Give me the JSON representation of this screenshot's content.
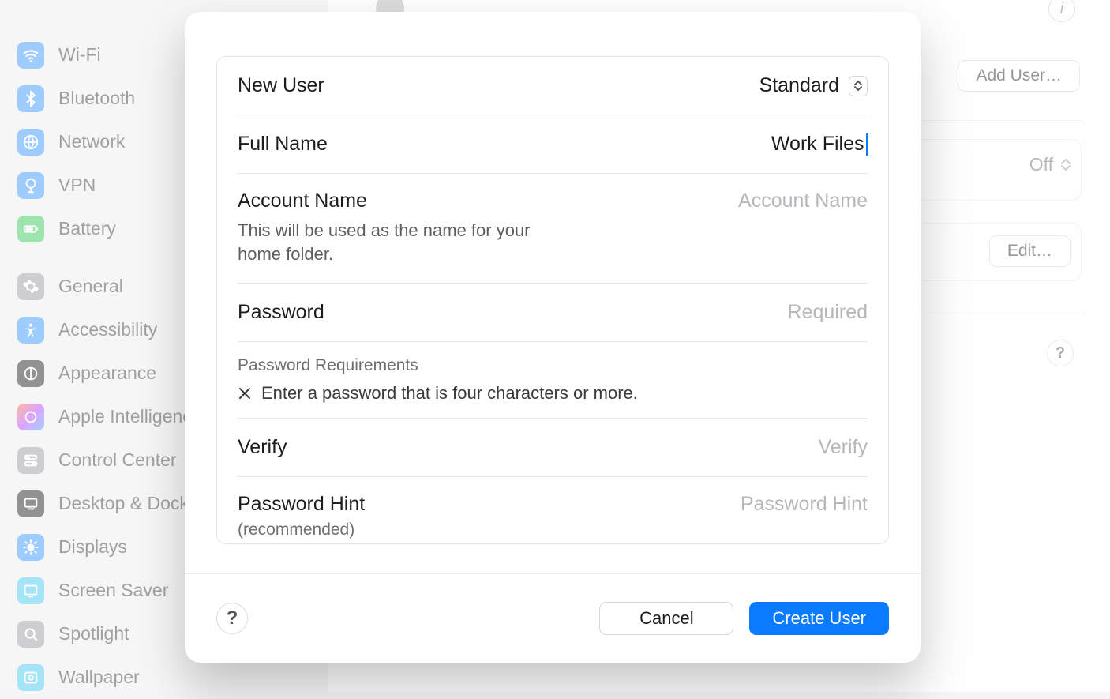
{
  "sidebar": {
    "items": [
      {
        "label": "Wi-Fi",
        "icon": "wifi",
        "bg": "#3895ff"
      },
      {
        "label": "Bluetooth",
        "icon": "bluetooth",
        "bg": "#3895ff"
      },
      {
        "label": "Network",
        "icon": "network",
        "bg": "#3895ff"
      },
      {
        "label": "VPN",
        "icon": "vpn",
        "bg": "#3895ff"
      },
      {
        "label": "Battery",
        "icon": "battery",
        "bg": "#34c759"
      },
      {
        "label": "General",
        "icon": "general",
        "bg": "#9a9aa0"
      },
      {
        "label": "Accessibility",
        "icon": "accessibility",
        "bg": "#3895ff"
      },
      {
        "label": "Appearance",
        "icon": "appearance",
        "bg": "#1c1c1e"
      },
      {
        "label": "Apple Intelligence",
        "icon": "ai",
        "bg": "linear-gradient(135deg,#ff6a3d,#b541ff,#3aa2ff)"
      },
      {
        "label": "Control Center",
        "icon": "control",
        "bg": "#9a9aa0"
      },
      {
        "label": "Desktop & Dock",
        "icon": "desktop",
        "bg": "#1c1c1e"
      },
      {
        "label": "Displays",
        "icon": "displays",
        "bg": "#3895ff"
      },
      {
        "label": "Screen Saver",
        "icon": "screensaver",
        "bg": "#44c7ef"
      },
      {
        "label": "Spotlight",
        "icon": "spotlight",
        "bg": "#9a9aa0"
      },
      {
        "label": "Wallpaper",
        "icon": "wallpaper",
        "bg": "#44c7ef"
      }
    ]
  },
  "background": {
    "add_user_label": "Add User…",
    "off_label": "Off",
    "edit_label": "Edit…"
  },
  "form": {
    "new_user_label": "New User",
    "user_type": "Standard",
    "full_name_label": "Full Name",
    "full_name_value": "Work Files",
    "account_name_label": "Account Name",
    "account_name_hint": "This will be used as the name for your home folder.",
    "account_name_placeholder": "Account Name",
    "account_name_value": "",
    "password_label": "Password",
    "password_placeholder": "Required",
    "password_value": "",
    "req_title": "Password Requirements",
    "req_rule": "Enter a password that is four characters or more.",
    "verify_label": "Verify",
    "verify_placeholder": "Verify",
    "verify_value": "",
    "hint_label": "Password Hint",
    "hint_sub": "(recommended)",
    "hint_placeholder": "Password Hint",
    "hint_value": ""
  },
  "actions": {
    "help": "?",
    "cancel": "Cancel",
    "create": "Create User"
  }
}
